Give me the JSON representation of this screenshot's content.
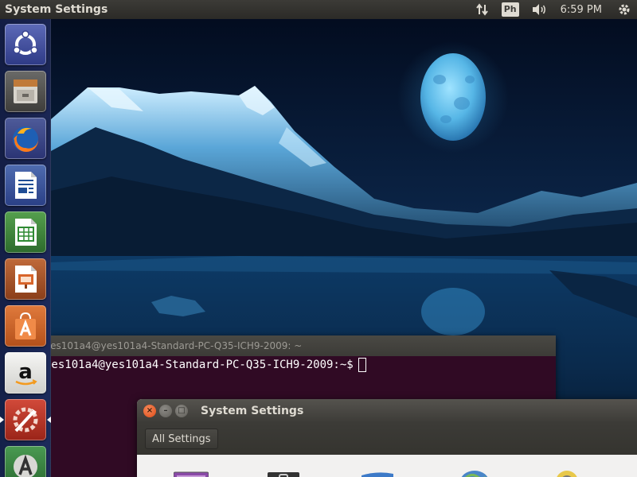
{
  "top_panel": {
    "app_title": "System Settings",
    "indicators": {
      "network_icon": "network-transfer-icon",
      "keyboard_layout": "Ph",
      "volume_icon": "volume-icon",
      "clock": "6:59 PM",
      "settings_icon": "gear-icon"
    }
  },
  "launcher": {
    "items": [
      {
        "name": "ubuntu-dash",
        "icon": "ubuntu-logo-icon"
      },
      {
        "name": "files",
        "icon": "file-cabinet-icon"
      },
      {
        "name": "firefox",
        "icon": "firefox-icon"
      },
      {
        "name": "libreoffice-writer",
        "icon": "writer-document-icon"
      },
      {
        "name": "libreoffice-calc",
        "icon": "calc-spreadsheet-icon"
      },
      {
        "name": "libreoffice-impress",
        "icon": "impress-presentation-icon"
      },
      {
        "name": "ubuntu-software",
        "icon": "shopping-bag-icon"
      },
      {
        "name": "amazon",
        "icon": "amazon-icon"
      },
      {
        "name": "system-settings",
        "icon": "settings-tools-icon"
      },
      {
        "name": "software-updater",
        "icon": "updater-icon"
      }
    ]
  },
  "terminal": {
    "title": "yes101a4@yes101a4-Standard-PC-Q35-ICH9-2009: ~",
    "prompt": "yes101a4@yes101a4-Standard-PC-Q35-ICH9-2009:~$"
  },
  "settings_window": {
    "title": "System Settings",
    "all_settings_label": "All Settings"
  },
  "colors": {
    "panel": "#3c3b37",
    "terminal_bg": "#300a24",
    "close_button": "#df4a16"
  }
}
